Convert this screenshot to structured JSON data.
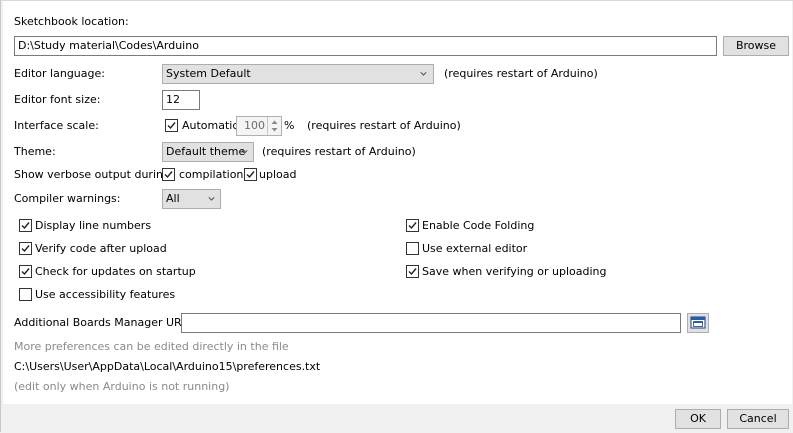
{
  "sketchbook": {
    "label": "Sketchbook location:",
    "path": "D:\\Study material\\Codes\\Arduino",
    "browse_label": "Browse"
  },
  "editor_language": {
    "label": "Editor language:",
    "value": "System Default",
    "note": "(requires restart of Arduino)"
  },
  "font_size": {
    "label": "Editor font size:",
    "value": "12"
  },
  "interface_scale": {
    "label": "Interface scale:",
    "automatic_label": "Automatic",
    "automatic_checked": true,
    "scale_value": "100",
    "percent_sign": "%",
    "note": "(requires restart of Arduino)"
  },
  "theme": {
    "label": "Theme:",
    "value": "Default theme",
    "note": "(requires restart of Arduino)"
  },
  "verbose": {
    "label": "Show verbose output during:",
    "compilation_label": "compilation",
    "compilation_checked": true,
    "upload_label": "upload",
    "upload_checked": true
  },
  "compiler_warnings": {
    "label": "Compiler warnings:",
    "value": "All"
  },
  "options_left": [
    {
      "label": "Display line numbers",
      "checked": true
    },
    {
      "label": "Verify code after upload",
      "checked": true
    },
    {
      "label": "Check for updates on startup",
      "checked": true
    },
    {
      "label": "Use accessibility features",
      "checked": false
    }
  ],
  "options_right": [
    {
      "label": "Enable Code Folding",
      "checked": true
    },
    {
      "label": "Use external editor",
      "checked": false
    },
    {
      "label": "Save when verifying or uploading",
      "checked": true
    }
  ],
  "boards_manager": {
    "label": "Additional Boards Manager URLs:",
    "value": "",
    "icon": "open-window-icon"
  },
  "info": {
    "more_prefs": "More preferences can be edited directly in the file",
    "prefs_path": "C:\\Users\\User\\AppData\\Local\\Arduino15\\preferences.txt",
    "edit_note": "(edit only when Arduino is not running)"
  },
  "footer": {
    "ok_label": "OK",
    "cancel_label": "Cancel"
  },
  "colors": {
    "dialog_bg": "#f0f0f0",
    "content_bg": "#ffffff",
    "button_bg": "#e1e1e1",
    "muted_text": "#8a8a8a"
  }
}
